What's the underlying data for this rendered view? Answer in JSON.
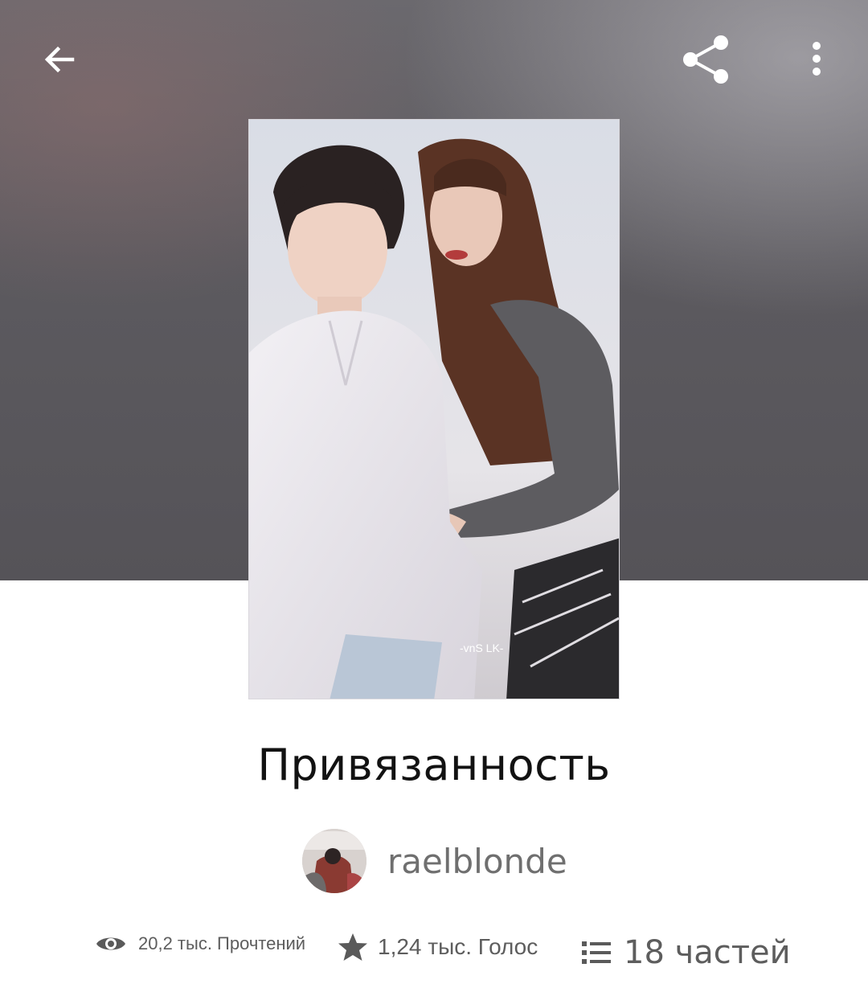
{
  "story": {
    "title": "Привязанность",
    "author": "raelblonde"
  },
  "stats": {
    "reads": "20,2 тыс. Прочтений",
    "votes": "1,24 тыс. Голос",
    "parts": "18 частей"
  },
  "cover": {
    "watermark": "-vnS LK-"
  },
  "icons": {
    "back": "arrow-left-icon",
    "share": "share-icon",
    "more": "more-vertical-icon",
    "reads": "eye-icon",
    "votes": "star-icon",
    "parts": "list-icon"
  },
  "colors": {
    "header_bg": "#5c5a5f",
    "title": "#121212",
    "muted_text": "#5d5d5d",
    "icon_dark": "#5a5a5a"
  }
}
